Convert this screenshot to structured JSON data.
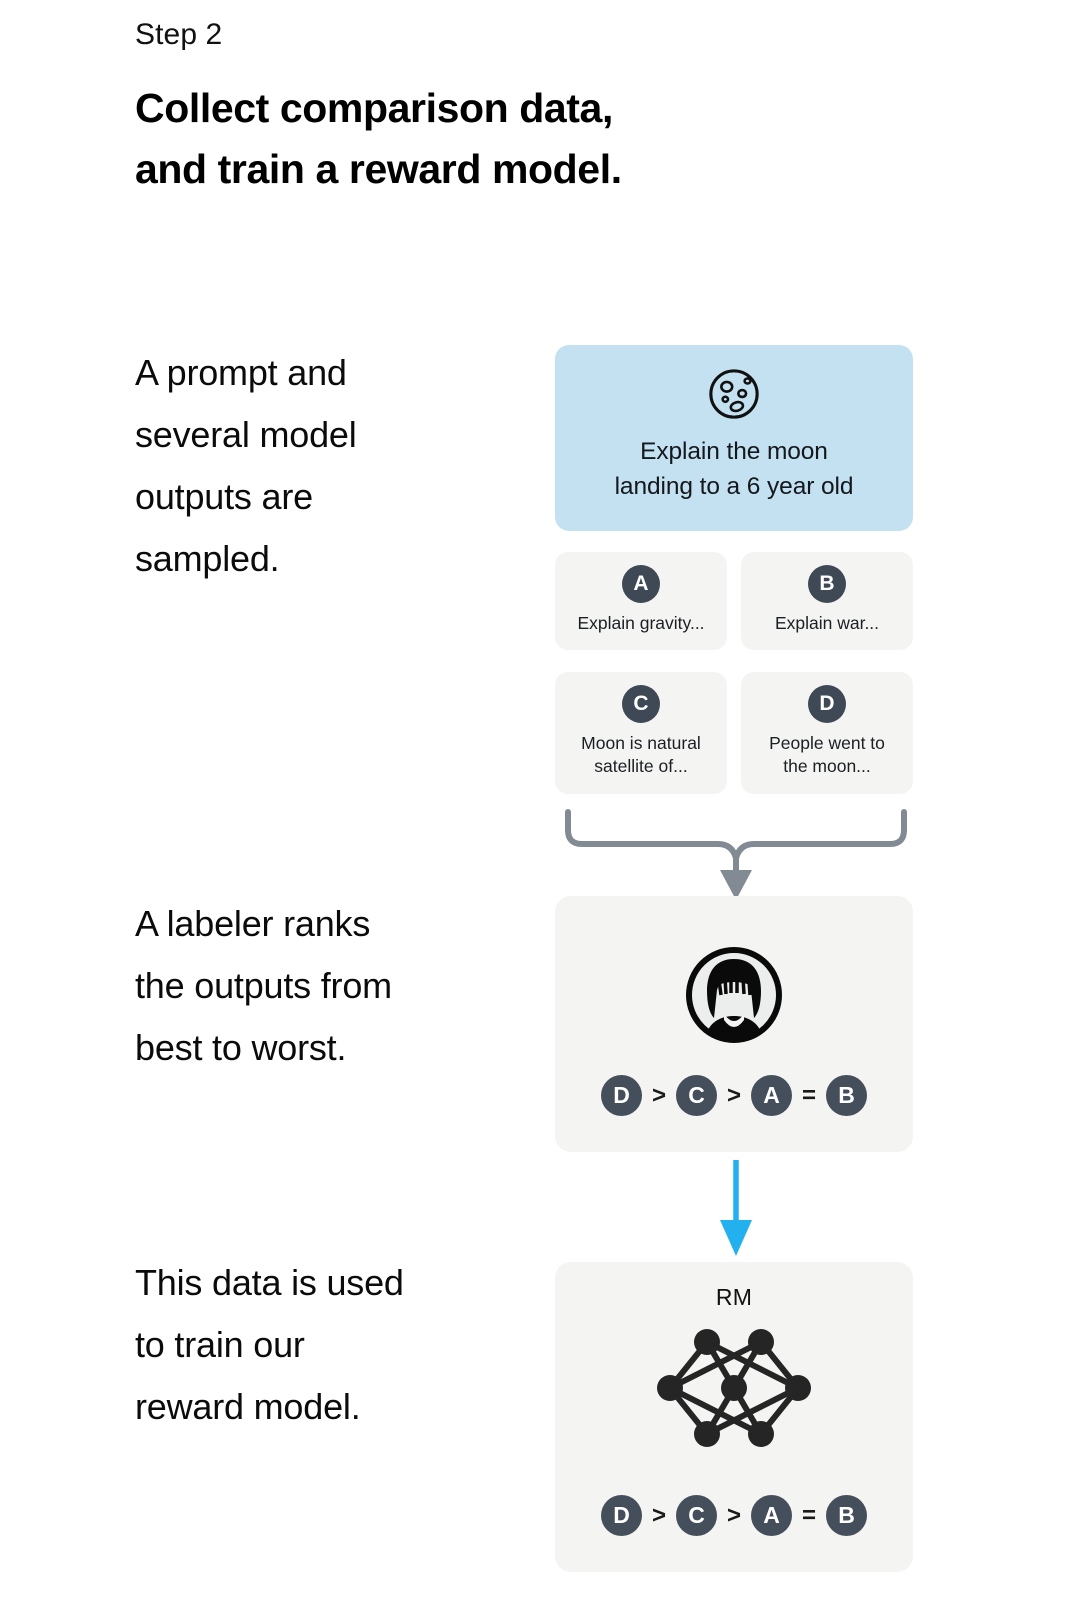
{
  "header": {
    "step_label": "Step 2",
    "headline": "Collect comparison data,\nand train a reward model."
  },
  "narrative": [
    "A prompt and\nseveral model\noutputs are\nsampled.",
    "A labeler ranks\nthe outputs from\nbest to worst.",
    "This data is used\nto train our\nreward model."
  ],
  "prompt_card": {
    "icon": "moon-icon",
    "text": "Explain the moon\nlanding to a 6 year old",
    "background_color": "#c3e1f0"
  },
  "outputs": [
    {
      "badge": "A",
      "text": "Explain gravity..."
    },
    {
      "badge": "B",
      "text": "Explain war..."
    },
    {
      "badge": "C",
      "text": "Moon is natural\nsatellite of..."
    },
    {
      "badge": "D",
      "text": "People went to\nthe moon..."
    }
  ],
  "connector": {
    "brace_icon": "merge-brace-arrow-icon",
    "brace_color": "#828a93",
    "blue_arrow_icon": "down-arrow-icon",
    "blue_arrow_color": "#23b0ef"
  },
  "labeler_card": {
    "avatar_icon": "person-avatar-icon",
    "ranking": [
      {
        "type": "badge",
        "label": "D"
      },
      {
        "type": "op",
        "label": ">"
      },
      {
        "type": "badge",
        "label": "C"
      },
      {
        "type": "op",
        "label": ">"
      },
      {
        "type": "badge",
        "label": "A"
      },
      {
        "type": "op",
        "label": "="
      },
      {
        "type": "badge",
        "label": "B"
      }
    ],
    "background_color": "#f4f4f2"
  },
  "rm_card": {
    "title": "RM",
    "network_icon": "neural-network-icon",
    "ranking": [
      {
        "type": "badge",
        "label": "D"
      },
      {
        "type": "op",
        "label": ">"
      },
      {
        "type": "badge",
        "label": "C"
      },
      {
        "type": "op",
        "label": ">"
      },
      {
        "type": "badge",
        "label": "A"
      },
      {
        "type": "op",
        "label": "="
      },
      {
        "type": "badge",
        "label": "B"
      }
    ],
    "background_color": "#f4f4f2"
  },
  "colors": {
    "badge_dark": "#3f4855",
    "prompt_blue": "#c3e1f0",
    "card_gray": "#f4f4f2",
    "accent_blue": "#23b0ef"
  }
}
